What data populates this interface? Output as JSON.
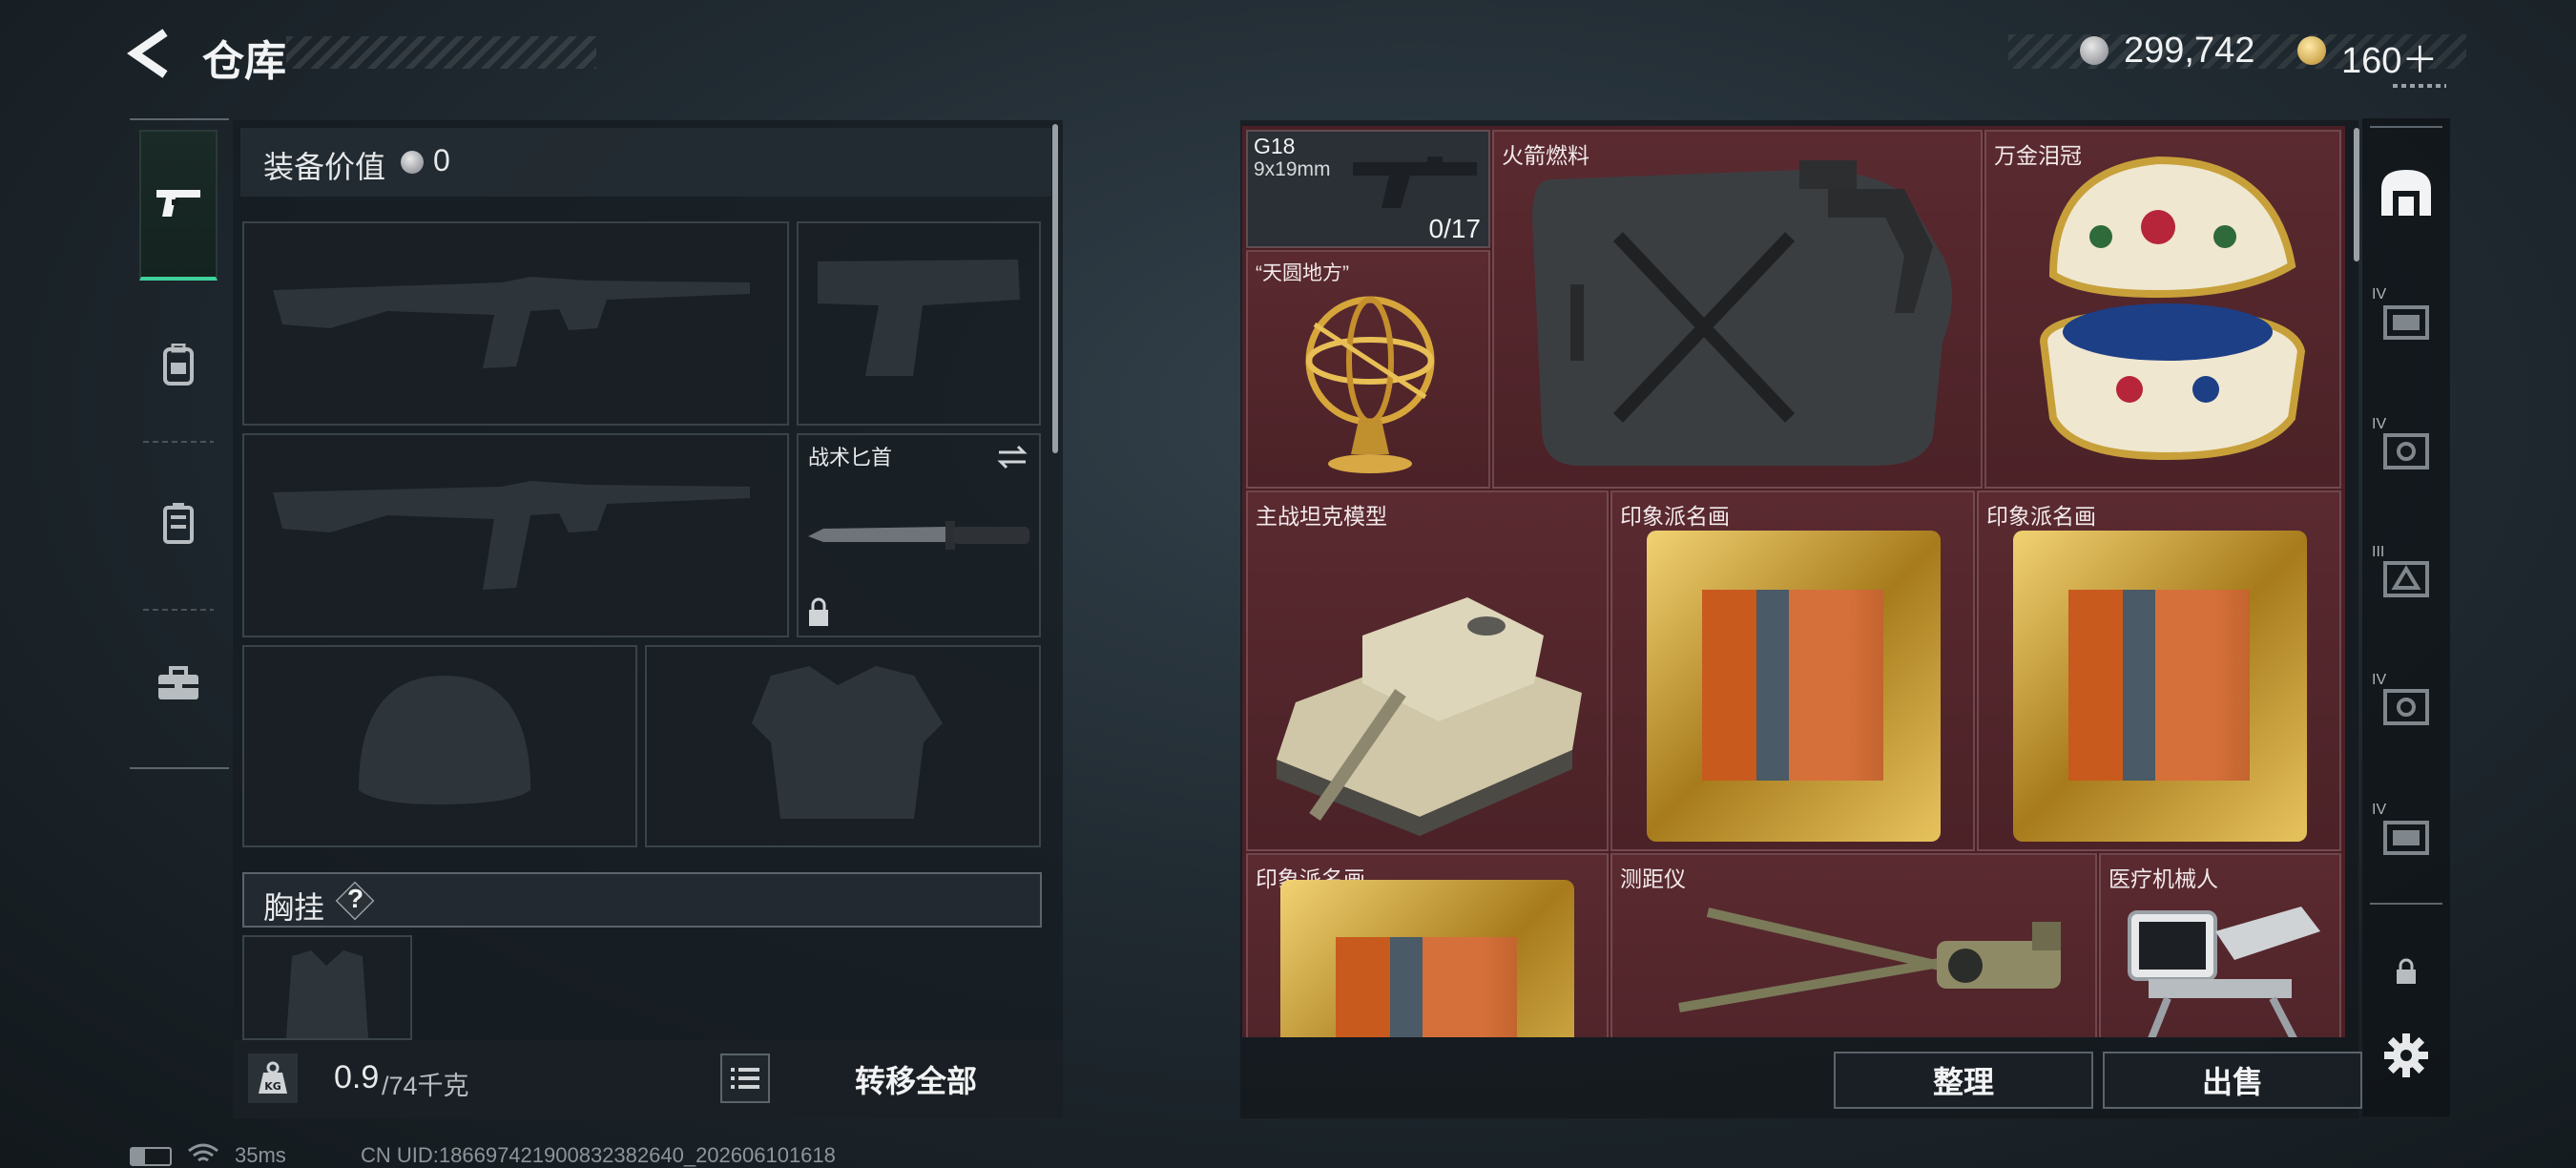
{
  "header": {
    "title": "仓库",
    "currency_main": "299,742",
    "currency_premium": "160＋",
    "back_icon": "back-arrow-icon"
  },
  "left_tabs": [
    {
      "icon": "pistol-icon",
      "active": true
    },
    {
      "icon": "backpack-icon",
      "active": false
    },
    {
      "icon": "locker-icon",
      "active": false
    },
    {
      "icon": "toolbox-icon",
      "active": false
    }
  ],
  "equipment": {
    "value_label": "装备价值",
    "value": "0",
    "melee_label": "战术匕首",
    "chest_rig_label": "胸挂",
    "chest_rig_help": "?"
  },
  "bottom_bar": {
    "weight_current": "0.9",
    "weight_max": "/74千克",
    "transfer_all": "转移全部"
  },
  "warehouse": {
    "items": [
      {
        "name": "G18",
        "sub": "9x19mm",
        "count": "0/17"
      },
      {
        "name": "火箭燃料"
      },
      {
        "name": "万金泪冠"
      },
      {
        "name": "“天圆地方”"
      },
      {
        "name": "主战坦克模型"
      },
      {
        "name": "印象派名画"
      },
      {
        "name": "印象派名画"
      },
      {
        "name": "印象派名画"
      },
      {
        "name": "测距仪"
      },
      {
        "name": "医疗机械人"
      }
    ],
    "sort_button": "整理",
    "sell_button": "出售"
  },
  "right_tabs": [
    {
      "icon": "warehouse-icon",
      "tier": ""
    },
    {
      "icon": "storage-box-icon",
      "tier": "IV"
    },
    {
      "icon": "safe-icon",
      "tier": "IV"
    },
    {
      "icon": "triangle-box-icon",
      "tier": "III"
    },
    {
      "icon": "safe-icon",
      "tier": "IV"
    },
    {
      "icon": "storage-box-icon",
      "tier": "IV"
    },
    {
      "icon": "lock-icon",
      "tier": ""
    },
    {
      "icon": "gear-icon",
      "tier": ""
    }
  ],
  "status": {
    "ping": "35ms",
    "uid": "CN UID:1866974219008323826​40_202606101618"
  },
  "colors": {
    "accent": "#3fd19b",
    "grid_bg": "#4a2026",
    "panel_bg": "#161c21"
  }
}
